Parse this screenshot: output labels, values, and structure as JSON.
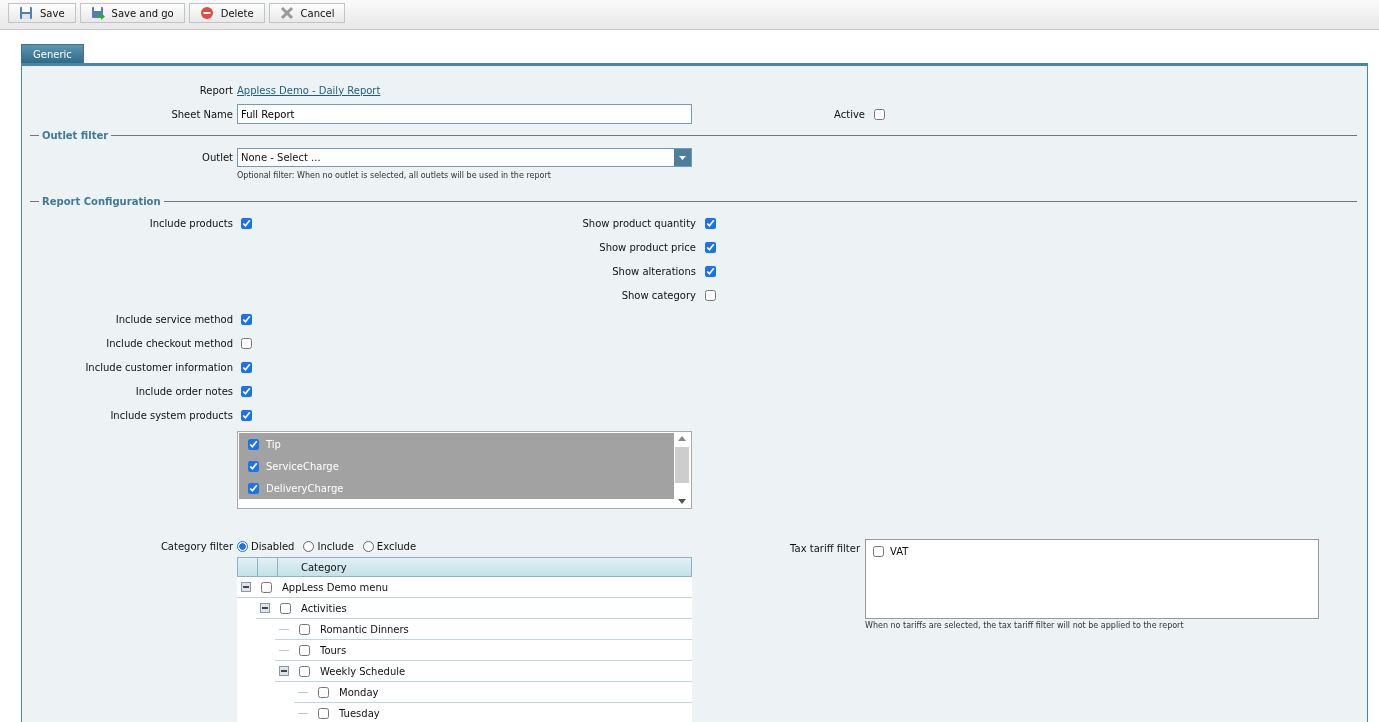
{
  "toolbar": {
    "buttons": [
      {
        "kind": "save",
        "label": "Save"
      },
      {
        "kind": "save-go",
        "label": "Save and go"
      },
      {
        "kind": "delete",
        "label": "Delete"
      },
      {
        "kind": "cancel",
        "label": "Cancel"
      }
    ]
  },
  "tabs": [
    {
      "label": "Generic",
      "selected": true
    }
  ],
  "general": {
    "report_label": "Report",
    "report_link": "Appless Demo - Daily Report",
    "sheet_name_label": "Sheet Name",
    "sheet_name": "Full Report",
    "active": {
      "label": "Active",
      "checked": false
    }
  },
  "outlet_filter": {
    "legend": "Outlet filter",
    "label": "Outlet",
    "value": "None - Select ...",
    "hint": "Optional filter: When no outlet is selected, all outlets will be used in the report"
  },
  "report_configuration": {
    "legend": "Report Configuration",
    "include_products": {
      "label": "Include products",
      "checked": true
    },
    "display_options": [
      {
        "label": "Show product quantity",
        "checked": true
      },
      {
        "label": "Show product price",
        "checked": true
      },
      {
        "label": "Show alterations",
        "checked": true
      },
      {
        "label": "Show category",
        "checked": false
      }
    ],
    "include_options": [
      {
        "label": "Include service method",
        "checked": true
      },
      {
        "label": "Include checkout method",
        "checked": false
      },
      {
        "label": "Include customer information",
        "checked": true
      },
      {
        "label": "Include order notes",
        "checked": true
      },
      {
        "label": "Include system products",
        "checked": true
      }
    ],
    "system_products": [
      {
        "label": "Tip",
        "checked": true,
        "selected": true
      },
      {
        "label": "ServiceCharge",
        "checked": true,
        "selected": true
      },
      {
        "label": "DeliveryCharge",
        "checked": true,
        "selected": true
      }
    ],
    "category_filter": {
      "label": "Category filter",
      "options": [
        {
          "label": "Disabled",
          "selected": true
        },
        {
          "label": "Include",
          "selected": false
        },
        {
          "label": "Exclude",
          "selected": false
        }
      ],
      "column": "Category",
      "tree": [
        {
          "label": "AppLess Demo menu",
          "checked": false,
          "expanded": true,
          "children": [
            {
              "label": "Activities",
              "checked": false,
              "expanded": true,
              "children": [
                {
                  "label": "Romantic Dinners",
                  "checked": false
                },
                {
                  "label": "Tours",
                  "checked": false
                },
                {
                  "label": "Weekly Schedule",
                  "checked": false,
                  "expanded": true,
                  "children": [
                    {
                      "label": "Monday",
                      "checked": false
                    },
                    {
                      "label": "Tuesday",
                      "checked": false
                    }
                  ]
                }
              ]
            }
          ]
        }
      ]
    },
    "tax_tariff_filter": {
      "label": "Tax tariff filter",
      "items": [
        {
          "label": "VAT",
          "checked": false
        }
      ],
      "hint": "When no tariffs are selected, the tax tariff filter will not be applied to the report"
    }
  }
}
